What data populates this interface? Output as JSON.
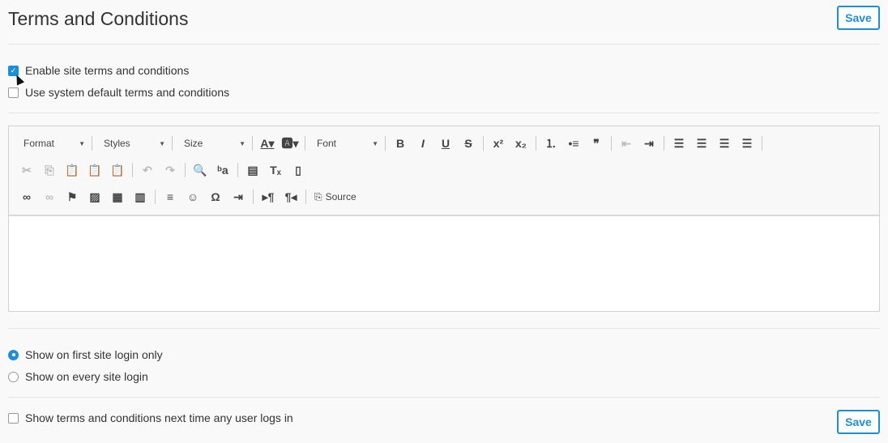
{
  "header": {
    "title": "Terms and Conditions",
    "save_label": "Save"
  },
  "options": {
    "enable": {
      "label": "Enable site terms and conditions",
      "checked": true
    },
    "system_default": {
      "label": "Use system default terms and conditions",
      "checked": false
    }
  },
  "editor": {
    "combos": [
      "Format",
      "Styles",
      "Size",
      "Font"
    ],
    "rows": [
      [
        {
          "c": 0
        },
        {
          "s": 1
        },
        {
          "c": 1
        },
        {
          "s": 1
        },
        {
          "c": 2
        },
        {
          "s": 1
        },
        {
          "i": "text-color"
        },
        {
          "i": "background-color"
        },
        {
          "s": 1
        },
        {
          "c": 3
        },
        {
          "s": 1
        },
        {
          "i": "bold"
        },
        {
          "i": "italic"
        },
        {
          "i": "underline"
        },
        {
          "i": "strikethrough"
        },
        {
          "s": 1
        },
        {
          "i": "superscript"
        },
        {
          "i": "subscript"
        },
        {
          "s": 1
        },
        {
          "i": "numbered-list"
        },
        {
          "i": "bulleted-list"
        },
        {
          "i": "blockquote"
        },
        {
          "s": 1
        },
        {
          "i": "outdent",
          "d": 1
        },
        {
          "i": "indent"
        },
        {
          "s": 1
        },
        {
          "i": "align-left"
        },
        {
          "i": "align-right"
        },
        {
          "i": "align-center"
        },
        {
          "i": "justify"
        },
        {
          "s": 1
        }
      ],
      [
        {
          "i": "cut",
          "d": 1
        },
        {
          "i": "copy",
          "d": 1
        },
        {
          "i": "paste"
        },
        {
          "i": "paste-text"
        },
        {
          "i": "paste-word"
        },
        {
          "s": 1
        },
        {
          "i": "undo",
          "d": 1
        },
        {
          "i": "redo",
          "d": 1
        },
        {
          "s": 1
        },
        {
          "i": "find"
        },
        {
          "i": "replace"
        },
        {
          "s": 1
        },
        {
          "i": "select-all"
        },
        {
          "i": "remove-format"
        },
        {
          "i": "create-div"
        }
      ],
      [
        {
          "i": "link"
        },
        {
          "i": "unlink",
          "d": 1
        },
        {
          "i": "anchor"
        },
        {
          "i": "image"
        },
        {
          "i": "table"
        },
        {
          "i": "video"
        },
        {
          "s": 1
        },
        {
          "i": "horizontal-line"
        },
        {
          "i": "smiley"
        },
        {
          "i": "special-char"
        },
        {
          "i": "page-break"
        },
        {
          "s": 1
        },
        {
          "i": "ltr"
        },
        {
          "i": "rtl"
        },
        {
          "s": 1
        },
        {
          "i": "source",
          "label": true
        }
      ]
    ],
    "source_label": "Source",
    "content": ""
  },
  "display": {
    "first_login": {
      "label": "Show on first site login only",
      "selected": true
    },
    "every_login": {
      "label": "Show on every site login",
      "selected": false
    }
  },
  "next_time": {
    "label": "Show terms and conditions next time any user logs in",
    "checked": false
  },
  "colors": {
    "accent": "#1d8fd6"
  }
}
